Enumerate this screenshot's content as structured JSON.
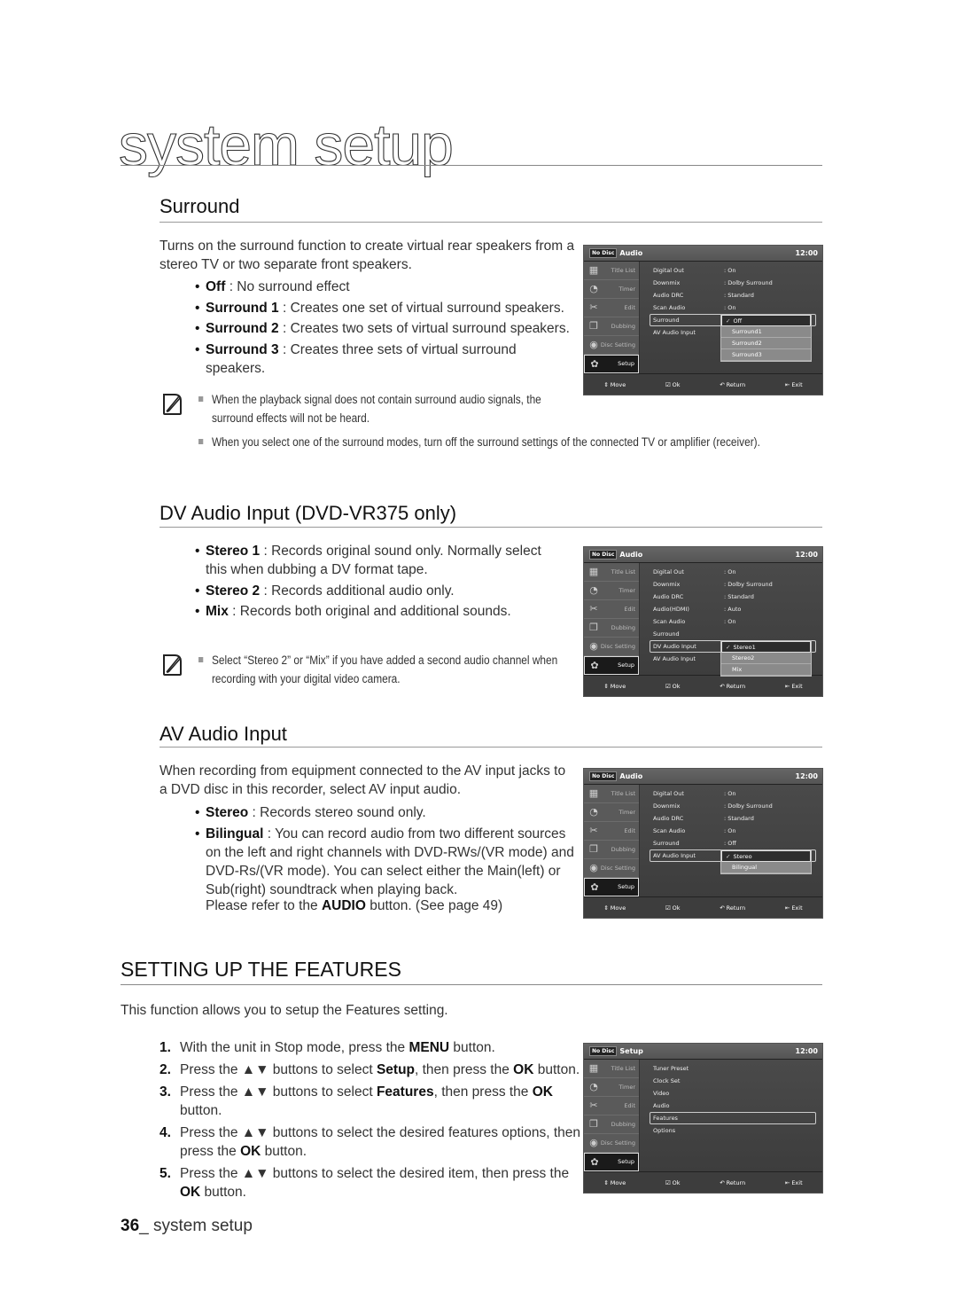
{
  "page": {
    "title": "system setup",
    "footer_page_number": "36",
    "footer_label": "_ system setup"
  },
  "surround": {
    "heading": "Surround",
    "intro": "Turns on the surround function to create virtual rear speakers from a stereo TV or two separate front speakers.",
    "bullets": [
      {
        "term": "Off",
        "desc": " : No surround effect"
      },
      {
        "term": "Surround 1",
        "desc": " : Creates one set of virtual surround speakers."
      },
      {
        "term": "Surround 2",
        "desc": " : Creates two sets of virtual surround speakers."
      },
      {
        "term": "Surround 3",
        "desc": " : Creates three sets of virtual surround speakers."
      }
    ],
    "notes": [
      "When the playback signal does not contain surround audio signals, the surround effects will not be heard.",
      "When you select one of the surround modes, turn off the surround settings of the connected TV or amplifier (receiver)."
    ]
  },
  "dv_audio": {
    "heading": "DV Audio Input (DVD-VR375 only)",
    "bullets": [
      {
        "term": "Stereo 1",
        "desc": " : Records original sound only. Normally select this when dubbing a DV format tape."
      },
      {
        "term": "Stereo 2",
        "desc": " : Records additional audio only."
      },
      {
        "term": "Mix",
        "desc": " : Records both original and additional sounds."
      }
    ],
    "notes": [
      "Select “Stereo 2” or “Mix” if you have added a second audio channel when recording with your digital video camera."
    ]
  },
  "av_audio": {
    "heading": "AV Audio Input",
    "intro": "When recording from equipment connected to the AV input jacks to a DVD disc in this recorder, select AV input audio.",
    "bullets": [
      {
        "term": "Stereo",
        "desc": " : Records stereo sound only."
      },
      {
        "term": "Bilingual",
        "desc": " : You can record audio from two different sources on the left and right channels with DVD-RWs/(VR mode) and DVD-Rs/(VR mode). You can select either the Main(left) or Sub(right) soundtrack when playing back."
      }
    ],
    "refer_pre": "Please refer to the ",
    "refer_term": "AUDIO",
    "refer_post": " button. (See page 49)"
  },
  "features": {
    "heading": "SETTING UP THE FEATURES",
    "intro": "This function allows you to setup the Features setting.",
    "steps": [
      {
        "num": "1.",
        "parts": [
          [
            "With the unit in Stop mode, press the ",
            false
          ],
          [
            "MENU",
            true
          ],
          [
            " button.",
            false
          ]
        ]
      },
      {
        "num": "2.",
        "parts": [
          [
            "Press the ▲▼ buttons to select ",
            false
          ],
          [
            "Setup",
            true
          ],
          [
            ", then press the ",
            false
          ],
          [
            "OK",
            true
          ],
          [
            " button.",
            false
          ]
        ]
      },
      {
        "num": "3.",
        "parts": [
          [
            "Press the ▲▼ buttons to select ",
            false
          ],
          [
            "Features",
            true
          ],
          [
            ", then press the ",
            false
          ],
          [
            "OK",
            true
          ],
          [
            " button.",
            false
          ]
        ]
      },
      {
        "num": "4.",
        "parts": [
          [
            "Press the ▲▼ buttons to select the desired features options, then press the ",
            false
          ],
          [
            "OK",
            true
          ],
          [
            " button.",
            false
          ]
        ]
      },
      {
        "num": "5.",
        "parts": [
          [
            "Press the ▲▼ buttons to select the desired item, then press the ",
            false
          ],
          [
            "OK",
            true
          ],
          [
            " button.",
            false
          ]
        ]
      }
    ]
  },
  "osd_common": {
    "disc": "No Disc",
    "time": "12:00",
    "sidebar": [
      {
        "label": "Title List",
        "icon": "film-icon"
      },
      {
        "label": "Timer",
        "icon": "clock-icon"
      },
      {
        "label": "Edit",
        "icon": "scissors-icon"
      },
      {
        "label": "Dubbing",
        "icon": "dubbing-icon"
      },
      {
        "label": "Disc Setting",
        "icon": "disc-icon"
      },
      {
        "label": "Setup",
        "icon": "gear-icon"
      }
    ],
    "footer": {
      "move": "Move",
      "ok": "Ok",
      "return": "Return",
      "exit": "Exit"
    }
  },
  "osd_screens": [
    {
      "title": "Audio",
      "rows": [
        {
          "label": "Digital Out",
          "value": ": On"
        },
        {
          "label": "Downmix",
          "value": ": Dolby Surround"
        },
        {
          "label": "Audio DRC",
          "value": ": Standard"
        },
        {
          "label": "Scan Audio",
          "value": ": On"
        },
        {
          "label": "Surround",
          "value": "",
          "selected": true
        },
        {
          "label": "AV Audio Input",
          "value": ""
        }
      ],
      "dropdown": [
        "Off",
        "Surround1",
        "Surround2",
        "Surround3"
      ],
      "dropdown_checked": 0
    },
    {
      "title": "Audio",
      "rows": [
        {
          "label": "Digital Out",
          "value": ": On"
        },
        {
          "label": "Downmix",
          "value": ": Dolby Surround"
        },
        {
          "label": "Audio DRC",
          "value": ": Standard"
        },
        {
          "label": "Audio(HDMI)",
          "value": ": Auto"
        },
        {
          "label": "Scan Audio",
          "value": ": On"
        },
        {
          "label": "Surround",
          "value": ""
        },
        {
          "label": "DV Audio Input",
          "value": "",
          "selected": true
        },
        {
          "label": "AV Audio Input",
          "value": ""
        }
      ],
      "dropdown": [
        "Stereo1",
        "Stereo2",
        "Mix"
      ],
      "dropdown_checked": 0
    },
    {
      "title": "Audio",
      "rows": [
        {
          "label": "Digital Out",
          "value": ": On"
        },
        {
          "label": "Downmix",
          "value": ": Dolby Surround"
        },
        {
          "label": "Audio DRC",
          "value": ": Standard"
        },
        {
          "label": "Scan Audio",
          "value": ": On"
        },
        {
          "label": "Surround",
          "value": ": Off"
        },
        {
          "label": "AV Audio Input",
          "value": "",
          "selected": true
        }
      ],
      "dropdown": [
        "Stereo",
        "Bilingual"
      ],
      "dropdown_checked": 0
    },
    {
      "title": "Setup",
      "rows": [
        {
          "label": "Tuner Preset",
          "value": ""
        },
        {
          "label": "Clock Set",
          "value": ""
        },
        {
          "label": "Video",
          "value": ""
        },
        {
          "label": "Audio",
          "value": ""
        },
        {
          "label": "Features",
          "value": "",
          "selected": true
        },
        {
          "label": "Options",
          "value": ""
        }
      ],
      "dropdown": [],
      "dropdown_checked": -1
    }
  ]
}
